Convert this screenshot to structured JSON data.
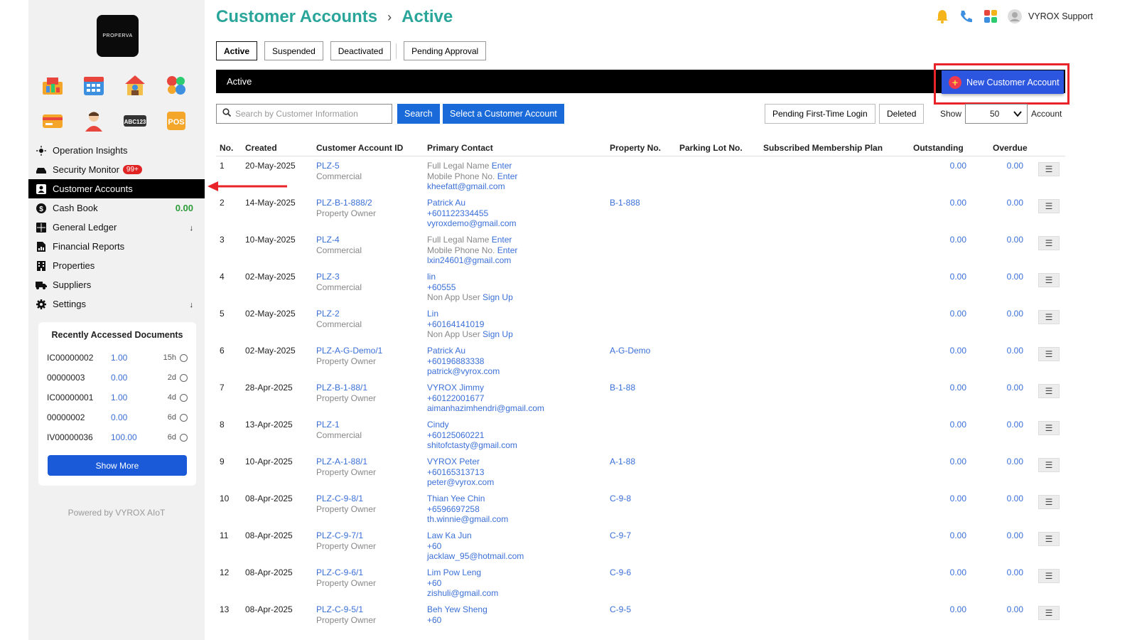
{
  "sidebar": {
    "logo_text": "PROPERVA",
    "apps": [
      "presentation-icon",
      "calendar-icon",
      "house-icon",
      "blocks-icon",
      "card-icon",
      "person-icon",
      "abc123-icon",
      "pos-icon"
    ],
    "items": [
      {
        "label": "Operation Insights",
        "icon": "sun-icon"
      },
      {
        "label": "Security Monitor",
        "icon": "car-icon",
        "badge": "99+"
      },
      {
        "label": "Customer Accounts",
        "icon": "id-card-icon",
        "active": true
      },
      {
        "label": "Cash Book",
        "icon": "dollar-icon",
        "amount": "0.00"
      },
      {
        "label": "General Ledger",
        "icon": "ledger-icon",
        "arrow": "↓"
      },
      {
        "label": "Financial Reports",
        "icon": "report-icon"
      },
      {
        "label": "Properties",
        "icon": "building-icon"
      },
      {
        "label": "Suppliers",
        "icon": "truck-icon"
      },
      {
        "label": "Settings",
        "icon": "gear-icon",
        "arrow": "↓"
      }
    ],
    "recent": {
      "title": "Recently Accessed Documents",
      "docs": [
        {
          "id": "IC00000002",
          "amount": "1.00",
          "age": "15h"
        },
        {
          "id": "00000003",
          "amount": "0.00",
          "age": "2d"
        },
        {
          "id": "IC00000001",
          "amount": "1.00",
          "age": "4d"
        },
        {
          "id": "00000002",
          "amount": "0.00",
          "age": "6d"
        },
        {
          "id": "IV00000036",
          "amount": "100.00",
          "age": "6d"
        }
      ],
      "show_more": "Show More"
    },
    "powered_by": "Powered by VYROX AIoT"
  },
  "header": {
    "title": "Customer Accounts",
    "separator": "›",
    "subtitle": "Active",
    "user_name": "VYROX Support"
  },
  "tabs": [
    "Active",
    "Suspended",
    "Deactivated",
    "Pending Approval"
  ],
  "bar_title": "Active",
  "new_button": "New Customer Account",
  "toolbar": {
    "search_placeholder": "Search by Customer Information",
    "search_button": "Search",
    "select_button": "Select a Customer Account",
    "pending_button": "Pending First-Time Login",
    "deleted_button": "Deleted",
    "show_label": "Show",
    "show_value": "50",
    "account_label": "Account"
  },
  "table": {
    "headers": {
      "no": "No.",
      "created": "Created",
      "account_id": "Customer Account ID",
      "contact": "Primary Contact",
      "property": "Property No.",
      "parking": "Parking Lot No.",
      "plan": "Subscribed Membership Plan",
      "outstanding": "Outstanding",
      "overdue": "Overdue"
    },
    "rows": [
      {
        "no": "1",
        "created": "20-May-2025",
        "acct": "PLZ-5",
        "type": "Commercial",
        "l1a": "Full Legal Name ",
        "l1b": "Enter",
        "l2a": "Mobile Phone No. ",
        "l2b": "Enter",
        "l3": "kheefatt@gmail.com",
        "prop": "",
        "out": "0.00",
        "over": "0.00"
      },
      {
        "no": "2",
        "created": "14-May-2025",
        "acct": "PLZ-B-1-888/2",
        "type": "Property Owner",
        "l1a": "",
        "l1b": "Patrick Au",
        "l2a": "",
        "l2b": "+601122334455",
        "l3": "vyroxdemo@gmail.com",
        "prop": "B-1-888",
        "out": "0.00",
        "over": "0.00"
      },
      {
        "no": "3",
        "created": "10-May-2025",
        "acct": "PLZ-4",
        "type": "Commercial",
        "l1a": "Full Legal Name ",
        "l1b": "Enter",
        "l2a": "Mobile Phone No. ",
        "l2b": "Enter",
        "l3": "lxin24601@gmail.com",
        "prop": "",
        "out": "0.00",
        "over": "0.00"
      },
      {
        "no": "4",
        "created": "02-May-2025",
        "acct": "PLZ-3",
        "type": "Commercial",
        "l1a": "",
        "l1b": "lin",
        "l2a": "",
        "l2b": "+60555",
        "l3a": "Non App User ",
        "l3b": "Sign Up",
        "prop": "",
        "out": "0.00",
        "over": "0.00"
      },
      {
        "no": "5",
        "created": "02-May-2025",
        "acct": "PLZ-2",
        "type": "Commercial",
        "l1a": "",
        "l1b": "Lin",
        "l2a": "",
        "l2b": "+60164141019",
        "l3a": "Non App User ",
        "l3b": "Sign Up",
        "prop": "",
        "out": "0.00",
        "over": "0.00"
      },
      {
        "no": "6",
        "created": "02-May-2025",
        "acct": "PLZ-A-G-Demo/1",
        "type": "Property Owner",
        "l1a": "",
        "l1b": "Patrick Au",
        "l2a": "",
        "l2b": "+60196883338",
        "l3": "patrick@vyrox.com",
        "prop": "A-G-Demo",
        "out": "0.00",
        "over": "0.00"
      },
      {
        "no": "7",
        "created": "28-Apr-2025",
        "acct": "PLZ-B-1-88/1",
        "type": "Property Owner",
        "l1a": "",
        "l1b": "VYROX Jimmy",
        "l2a": "",
        "l2b": "+60122001677",
        "l3": "aimanhazimhendri@gmail.com",
        "prop": "B-1-88",
        "out": "0.00",
        "over": "0.00"
      },
      {
        "no": "8",
        "created": "13-Apr-2025",
        "acct": "PLZ-1",
        "type": "Commercial",
        "l1a": "",
        "l1b": "Cindy",
        "l2a": "",
        "l2b": "+60125060221",
        "l3": "shitofctasty@gmail.com",
        "prop": "",
        "out": "0.00",
        "over": "0.00"
      },
      {
        "no": "9",
        "created": "10-Apr-2025",
        "acct": "PLZ-A-1-88/1",
        "type": "Property Owner",
        "l1a": "",
        "l1b": "VYROX Peter",
        "l2a": "",
        "l2b": "+60165313713",
        "l3": "peter@vyrox.com",
        "prop": "A-1-88",
        "out": "0.00",
        "over": "0.00"
      },
      {
        "no": "10",
        "created": "08-Apr-2025",
        "acct": "PLZ-C-9-8/1",
        "type": "Property Owner",
        "l1a": "",
        "l1b": "Thian Yee Chin",
        "l2a": "",
        "l2b": "+6596697258",
        "l3": "th.winnie@gmail.com",
        "prop": "C-9-8",
        "out": "0.00",
        "over": "0.00"
      },
      {
        "no": "11",
        "created": "08-Apr-2025",
        "acct": "PLZ-C-9-7/1",
        "type": "Property Owner",
        "l1a": "",
        "l1b": "Law Ka Jun",
        "l2a": "",
        "l2b": "+60",
        "l3": "jacklaw_95@hotmail.com",
        "prop": "C-9-7",
        "out": "0.00",
        "over": "0.00"
      },
      {
        "no": "12",
        "created": "08-Apr-2025",
        "acct": "PLZ-C-9-6/1",
        "type": "Property Owner",
        "l1a": "",
        "l1b": "Lim Pow Leng",
        "l2a": "",
        "l2b": "+60",
        "l3": "zishuli@gmail.com",
        "prop": "C-9-6",
        "out": "0.00",
        "over": "0.00"
      },
      {
        "no": "13",
        "created": "08-Apr-2025",
        "acct": "PLZ-C-9-5/1",
        "type": "Property Owner",
        "l1a": "",
        "l1b": "Beh Yew Sheng",
        "l2a": "",
        "l2b": "+60",
        "l3": "",
        "prop": "C-9-5",
        "out": "0.00",
        "over": "0.00"
      }
    ],
    "menu_glyph": "☰"
  },
  "colors": {
    "accent": "#2aa59a",
    "link": "#3a6fd8",
    "primary": "#1a6bd9",
    "highlight": "#e8232a"
  }
}
